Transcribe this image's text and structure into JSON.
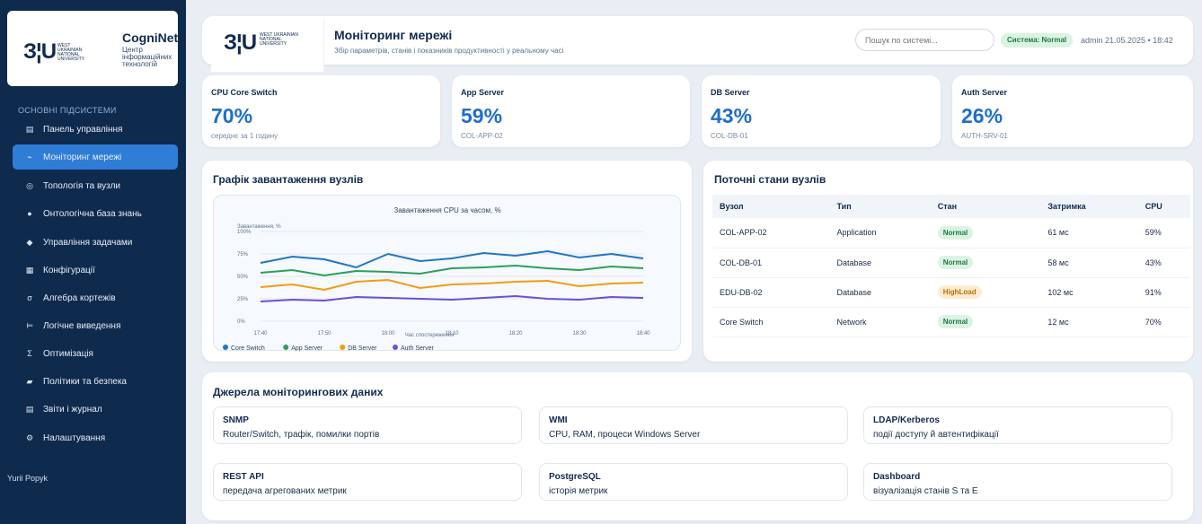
{
  "sidebar": {
    "brand_name": "CogniNet",
    "brand_sub": "Центр інформаційних технологій",
    "logo_mark": "З¦U",
    "logo_text": "WEST UKRAINIAN NATIONAL UNIVERSITY",
    "section_label": "ОСНОВНІ ПІДСИСТЕМИ",
    "items": [
      {
        "label": "Панель управління",
        "icon": "dashboard-icon",
        "glyph": "▤"
      },
      {
        "label": "Моніторинг мережі",
        "icon": "pulse-icon",
        "glyph": "⌁"
      },
      {
        "label": "Топологія та вузли",
        "icon": "topology-icon",
        "glyph": "◎"
      },
      {
        "label": "Онтологічна база знань",
        "icon": "knowledge-icon",
        "glyph": "●"
      },
      {
        "label": "Управління задачами",
        "icon": "diamond-icon",
        "glyph": "◆"
      },
      {
        "label": "Конфігурації",
        "icon": "config-icon",
        "glyph": "▦"
      },
      {
        "label": "Алгебра кортежів",
        "icon": "algebra-icon",
        "glyph": "σ"
      },
      {
        "label": "Логічне виведення",
        "icon": "inference-icon",
        "glyph": "⊨"
      },
      {
        "label": "Оптимізація",
        "icon": "sigma-icon",
        "glyph": "Σ"
      },
      {
        "label": "Політики та безпека",
        "icon": "shield-icon",
        "glyph": "▰"
      },
      {
        "label": "Звіти і журнал",
        "icon": "report-icon",
        "glyph": "▤"
      },
      {
        "label": "Налаштування",
        "icon": "gear-icon",
        "glyph": "⚙"
      }
    ],
    "active_index": 1,
    "user": "Yurii Popyk"
  },
  "header": {
    "logo_mark": "З¦U",
    "logo_text": "WEST UKRAINIAN NATIONAL UNIVERSITY",
    "title": "Моніторинг мережі",
    "subtitle": "Збір параметрів, станів і показників продуктивності у реальному часі",
    "search_placeholder": "Пошук по системі...",
    "status": "Система: Normal",
    "meta": "admin  21.05.2025 • 18:42"
  },
  "kpis": [
    {
      "label": "CPU Core Switch",
      "value": "70%",
      "sub": "середнє за 1 годину"
    },
    {
      "label": "App Server",
      "value": "59%",
      "sub": "COL-APP-02"
    },
    {
      "label": "DB Server",
      "value": "43%",
      "sub": "COL-DB-01"
    },
    {
      "label": "Auth Server",
      "value": "26%",
      "sub": "AUTH-SRV-01"
    }
  ],
  "chart_section_title": "Графік завантаження вузлів",
  "chart_data": {
    "type": "line",
    "title": "Завантаження CPU за часом, %",
    "ylabel": "Завантаження, %",
    "xlabel": "Час спостереження",
    "x": [
      "17:40",
      "17:45",
      "17:50",
      "17:55",
      "18:00",
      "18:05",
      "18:10",
      "18:15",
      "18:20",
      "18:25",
      "18:30",
      "18:35",
      "18:40"
    ],
    "x_ticks": [
      "17:40",
      "17:50",
      "18:00",
      "18:10",
      "18:20",
      "18:30",
      "18:40"
    ],
    "y_ticks": [
      "0%",
      "25%",
      "50%",
      "75%",
      "100%"
    ],
    "ylim": [
      0,
      100
    ],
    "grid": true,
    "legend": "bottom-left",
    "series": [
      {
        "name": "Core Switch",
        "color": "#1f77c4",
        "values": [
          65,
          72,
          69,
          60,
          75,
          67,
          70,
          76,
          73,
          78,
          71,
          75,
          70
        ]
      },
      {
        "name": "App Server",
        "color": "#2ca05a",
        "values": [
          54,
          57,
          51,
          56,
          55,
          53,
          59,
          60,
          62,
          59,
          57,
          61,
          59
        ]
      },
      {
        "name": "DB Server",
        "color": "#f39c12",
        "values": [
          38,
          41,
          35,
          44,
          46,
          37,
          41,
          42,
          44,
          45,
          39,
          42,
          43
        ]
      },
      {
        "name": "Auth Server",
        "color": "#6c4fd8",
        "values": [
          22,
          24,
          23,
          27,
          26,
          25,
          24,
          26,
          28,
          25,
          24,
          27,
          26
        ]
      }
    ]
  },
  "states": {
    "title": "Поточні стани вузлів",
    "columns": [
      "Вузол",
      "Тип",
      "Стан",
      "Затримка",
      "CPU"
    ],
    "rows": [
      {
        "node": "COL-APP-02",
        "type": "Application",
        "state": "Normal",
        "level": "normal",
        "latency": "61 мс",
        "cpu": "59%"
      },
      {
        "node": "COL-DB-01",
        "type": "Database",
        "state": "Normal",
        "level": "normal",
        "latency": "58 мс",
        "cpu": "43%"
      },
      {
        "node": "EDU-DB-02",
        "type": "Database",
        "state": "HighLoad",
        "level": "high",
        "latency": "102 мс",
        "cpu": "91%"
      },
      {
        "node": "Core Switch",
        "type": "Network",
        "state": "Normal",
        "level": "normal",
        "latency": "12 мс",
        "cpu": "70%"
      }
    ]
  },
  "sources": {
    "title": "Джерела моніторингових даних",
    "items": [
      {
        "name": "SNMP",
        "desc": "Router/Switch, трафік, помилки портів"
      },
      {
        "name": "WMI",
        "desc": "CPU, RAM, процеси Windows Server"
      },
      {
        "name": "LDAP/Kerberos",
        "desc": "події доступу й автентифікації"
      },
      {
        "name": "REST API",
        "desc": "передача агрегованих метрик"
      },
      {
        "name": "PostgreSQL",
        "desc": "історія метрик"
      },
      {
        "name": "Dashboard",
        "desc": "візуалізація станів S та E"
      }
    ]
  }
}
